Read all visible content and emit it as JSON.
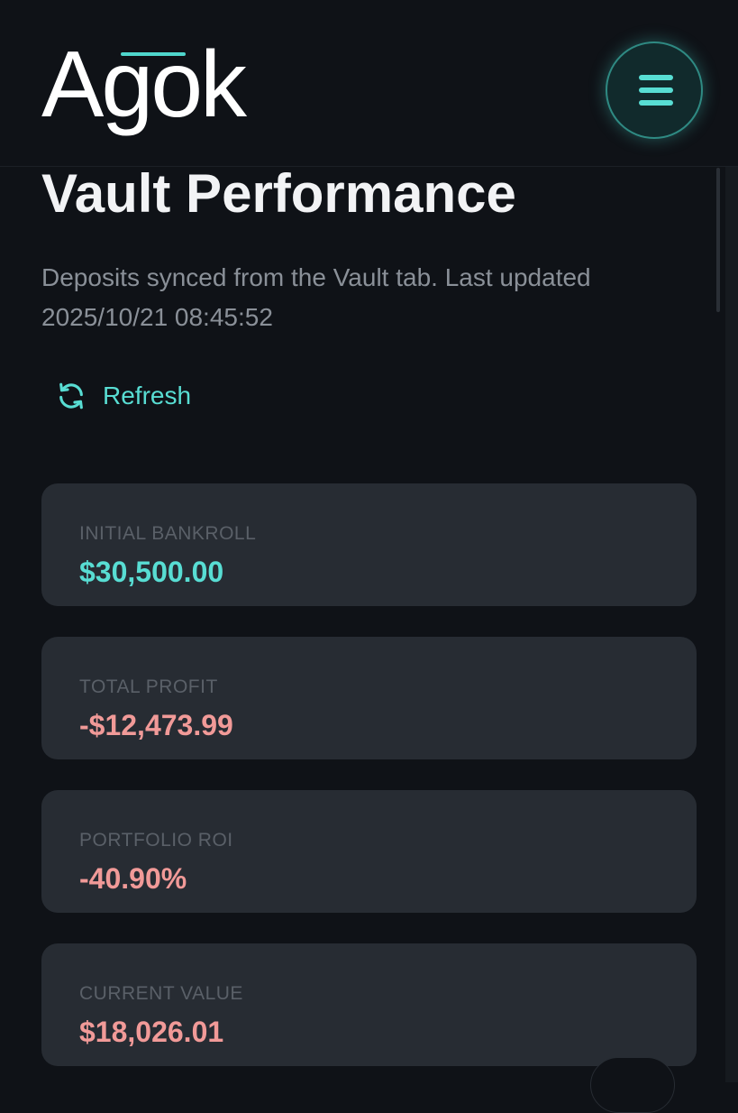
{
  "header": {
    "logo_text": "Agok",
    "menu_icon": "hamburger-menu-icon"
  },
  "page": {
    "title": "Vault Performance",
    "subtitle": "Deposits synced from the Vault tab. Last updated 2025/10/21 08:45:52"
  },
  "refresh": {
    "label": "Refresh",
    "icon": "refresh-icon"
  },
  "stats": [
    {
      "label": "INITIAL BANKROLL",
      "value": "$30,500.00",
      "color": "#58ddd3"
    },
    {
      "label": "TOTAL PROFIT",
      "value": "-$12,473.99",
      "color": "#f19a98"
    },
    {
      "label": "PORTFOLIO ROI",
      "value": "-40.90%",
      "color": "#f19a98"
    },
    {
      "label": "CURRENT VALUE",
      "value": "$18,026.01",
      "color": "#f19a98"
    }
  ],
  "colors": {
    "accent": "#58ddd3",
    "negative": "#f19a98",
    "background": "#0f1217",
    "card": "#272c33"
  }
}
